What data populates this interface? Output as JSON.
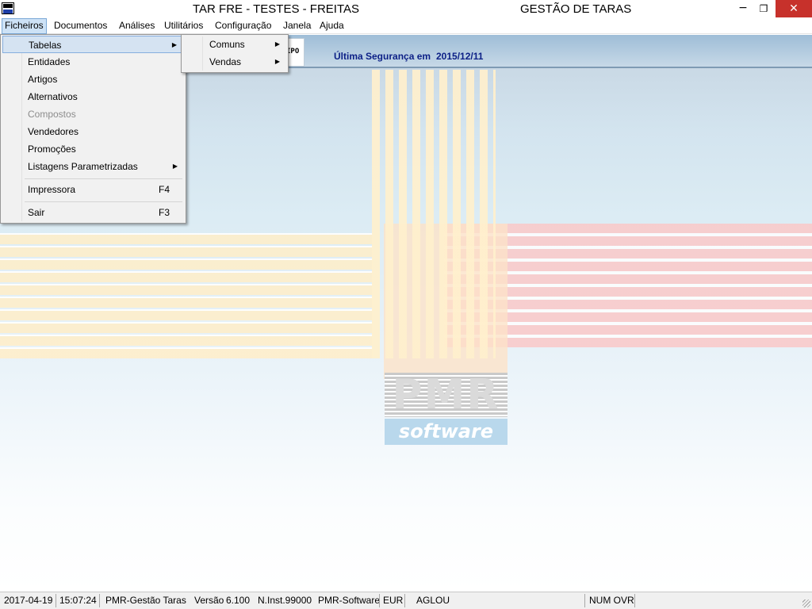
{
  "window": {
    "title": "TAR FRE - TESTES - FREITAS",
    "app_name": "GESTÃO DE TARAS",
    "minimize_glyph": "−",
    "restore_glyph": "❐",
    "close_glyph": "✕"
  },
  "menubar": {
    "items": [
      "Ficheiros",
      "Documentos",
      "Análises",
      "Utilitários",
      "Configuração",
      "Janela",
      "Ajuda"
    ],
    "active": "Ficheiros"
  },
  "header": {
    "tipo_label": "IPO",
    "backup_label": "Última Segurança em",
    "backup_date": "2015/12/11"
  },
  "logo": {
    "pmr_text": "PMR",
    "software_text": "software"
  },
  "ficheiros_menu": {
    "items": [
      {
        "label": "Tabelas",
        "shortcut": "",
        "submenu": true,
        "highlighted": true,
        "enabled": true
      },
      {
        "label": "Entidades",
        "shortcut": "",
        "submenu": false,
        "enabled": true
      },
      {
        "label": "Artigos",
        "shortcut": "",
        "submenu": false,
        "enabled": true
      },
      {
        "label": "Alternativos",
        "shortcut": "",
        "submenu": false,
        "enabled": true
      },
      {
        "label": "Compostos",
        "shortcut": "",
        "submenu": false,
        "enabled": false
      },
      {
        "label": "Vendedores",
        "shortcut": "",
        "submenu": false,
        "enabled": true
      },
      {
        "label": "Promoções",
        "shortcut": "",
        "submenu": false,
        "enabled": true
      },
      {
        "label": "Listagens Parametrizadas",
        "shortcut": "",
        "submenu": true,
        "enabled": true
      },
      {
        "label": "Impressora",
        "shortcut": "F4",
        "submenu": false,
        "enabled": true
      },
      {
        "label": "Sair",
        "shortcut": "F3",
        "submenu": false,
        "enabled": true
      }
    ]
  },
  "tabelas_submenu": {
    "items": [
      {
        "label": "Comuns",
        "submenu": true
      },
      {
        "label": "Vendas",
        "submenu": true
      }
    ]
  },
  "statusbar": {
    "date": "2017-04-19",
    "time": "15:07:24",
    "product": "PMR-Gestão Taras",
    "version_label": "Versão",
    "version": "6.100",
    "installation": "N.Inst.99000",
    "vendor": "PMR-Software",
    "currency": "EUR",
    "user": "AGLOU",
    "keys": "NUM OVR"
  },
  "colors": {
    "header_text": "#0b1f86",
    "close_button": "#c7312b",
    "menu_highlight": "#d5e3f2"
  }
}
